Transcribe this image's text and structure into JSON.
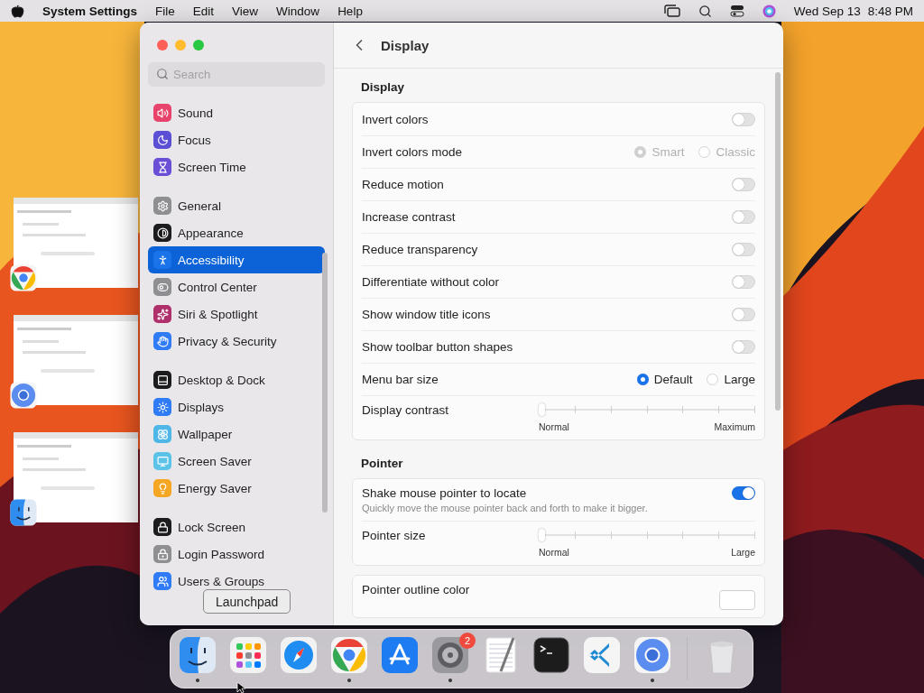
{
  "menu_bar": {
    "app": "System Settings",
    "menus": [
      "File",
      "Edit",
      "View",
      "Window",
      "Help"
    ],
    "date": "Wed Sep 13",
    "time": "8:48 PM"
  },
  "stage": [
    {
      "kind": "chrome"
    },
    {
      "kind": "chromium"
    },
    {
      "kind": "finder"
    }
  ],
  "window": {
    "title": "Display",
    "search": {
      "placeholder": "Search"
    },
    "sidebar": [
      [
        {
          "label": "Sound",
          "kind": "speaker",
          "color": "#e8436a",
          "selected": false
        },
        {
          "label": "Focus",
          "kind": "moon",
          "color": "#5b4fd6",
          "selected": false
        },
        {
          "label": "Screen Time",
          "kind": "hourglass",
          "color": "#6a4fd6",
          "selected": false
        }
      ],
      [
        {
          "label": "General",
          "kind": "gear",
          "color": "#8e8e93",
          "selected": false
        },
        {
          "label": "Appearance",
          "kind": "contrast",
          "color": "#1c1c1e",
          "selected": false
        },
        {
          "label": "Accessibility",
          "kind": "person",
          "color": "#1a73e8",
          "selected": true
        },
        {
          "label": "Control Center",
          "kind": "switches",
          "color": "#8e8e93",
          "selected": false
        },
        {
          "label": "Siri & Spotlight",
          "kind": "sparkle",
          "color": "#b0306b",
          "selected": false
        },
        {
          "label": "Privacy & Security",
          "kind": "hand",
          "color": "#2f7cf6",
          "selected": false
        }
      ],
      [
        {
          "label": "Desktop & Dock",
          "kind": "dock",
          "color": "#1c1c1e",
          "selected": false
        },
        {
          "label": "Displays",
          "kind": "sun",
          "color": "#2f7cf6",
          "selected": false
        },
        {
          "label": "Wallpaper",
          "kind": "flower",
          "color": "#4fb7e8",
          "selected": false
        },
        {
          "label": "Screen Saver",
          "kind": "monitor",
          "color": "#5cc3e8",
          "selected": false
        },
        {
          "label": "Energy Saver",
          "kind": "bulb",
          "color": "#f5a623",
          "selected": false
        }
      ],
      [
        {
          "label": "Lock Screen",
          "kind": "lock",
          "color": "#1c1c1e",
          "selected": false
        },
        {
          "label": "Login Password",
          "kind": "padlock",
          "color": "#8e8e93",
          "selected": false
        },
        {
          "label": "Users & Groups",
          "kind": "people",
          "color": "#2f7cf6",
          "selected": false
        }
      ]
    ],
    "sections": [
      {
        "heading": "Display",
        "groups": [
          [
            {
              "kind": "toggle",
              "label": "Invert colors",
              "on": false
            },
            {
              "kind": "radio",
              "label": "Invert colors mode",
              "disabled": true,
              "options": [
                {
                  "label": "Smart",
                  "selected": true
                },
                {
                  "label": "Classic",
                  "selected": false
                }
              ]
            },
            {
              "kind": "toggle",
              "label": "Reduce motion",
              "on": false
            },
            {
              "kind": "toggle",
              "label": "Increase contrast",
              "on": false
            },
            {
              "kind": "toggle",
              "label": "Reduce transparency",
              "on": false
            },
            {
              "kind": "toggle",
              "label": "Differentiate without color",
              "on": false
            },
            {
              "kind": "toggle",
              "label": "Show window title icons",
              "on": false
            },
            {
              "kind": "toggle",
              "label": "Show toolbar button shapes",
              "on": false
            },
            {
              "kind": "radio",
              "label": "Menu bar size",
              "disabled": false,
              "options": [
                {
                  "label": "Default",
                  "selected": true
                },
                {
                  "label": "Large",
                  "selected": false
                }
              ]
            },
            {
              "kind": "slider",
              "label": "Display contrast",
              "level": 0,
              "min_label": "Normal",
              "max_label": "Maximum"
            }
          ]
        ]
      },
      {
        "heading": "Pointer",
        "groups": [
          [
            {
              "kind": "toggle",
              "label": "Shake mouse pointer to locate",
              "description": "Quickly move the mouse pointer back and forth to make it bigger.",
              "on": true
            },
            {
              "kind": "slider",
              "label": "Pointer size",
              "level": 0,
              "min_label": "Normal",
              "max_label": "Large"
            }
          ],
          [
            {
              "kind": "color",
              "label": "Pointer outline color"
            }
          ]
        ]
      }
    ]
  },
  "tooltip": "Launchpad",
  "dock": [
    {
      "kind": "finder",
      "running": true
    },
    {
      "kind": "launchpad",
      "running": false
    },
    {
      "kind": "safari",
      "running": false
    },
    {
      "kind": "chrome",
      "running": true
    },
    {
      "kind": "appstore",
      "running": false
    },
    {
      "kind": "settings",
      "running": true,
      "badge": "2"
    },
    {
      "kind": "textedit",
      "running": false
    },
    {
      "kind": "terminal",
      "running": false
    },
    {
      "kind": "vscode",
      "running": false
    },
    {
      "kind": "chromium",
      "running": true
    },
    {
      "kind": "trash",
      "running": false
    }
  ]
}
